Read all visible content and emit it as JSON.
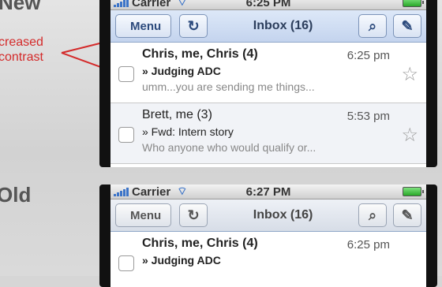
{
  "labels": {
    "new": "New",
    "old": "Old",
    "annotation": [
      "creased",
      "contrast"
    ]
  },
  "colors": {
    "annotation": "#d42a2a",
    "new_nav": "#c4d4ee",
    "old_nav": "#d7dde7",
    "accent": "#2c4a7c"
  },
  "new_phone": {
    "status": {
      "carrier": "Carrier",
      "time": "6:25 PM",
      "wifi_icon": "wifi-icon"
    },
    "nav": {
      "menu_label": "Menu",
      "title": "Inbox (16)",
      "refresh_icon": "refresh-icon",
      "search_icon": "search-icon",
      "compose_icon": "compose-icon"
    },
    "rows": [
      {
        "from": "Chris, me, Chris (4)",
        "time": "6:25 pm",
        "subject": "» Judging ADC",
        "snippet": "umm...you are sending me things..."
      },
      {
        "from": "Brett, me (3)",
        "time": "5:53 pm",
        "subject": "» Fwd: Intern story",
        "snippet": "Who anyone who would qualify or..."
      }
    ]
  },
  "old_phone": {
    "status": {
      "carrier": "Carrier",
      "time": "6:27 PM",
      "wifi_icon": "wifi-icon"
    },
    "nav": {
      "menu_label": "Menu",
      "title": "Inbox (16)",
      "refresh_icon": "refresh-icon",
      "search_icon": "search-icon",
      "compose_icon": "compose-icon"
    },
    "rows": [
      {
        "from": "Chris, me, Chris (4)",
        "time": "6:25 pm",
        "subject": "» Judging ADC",
        "snippet": ""
      }
    ]
  }
}
